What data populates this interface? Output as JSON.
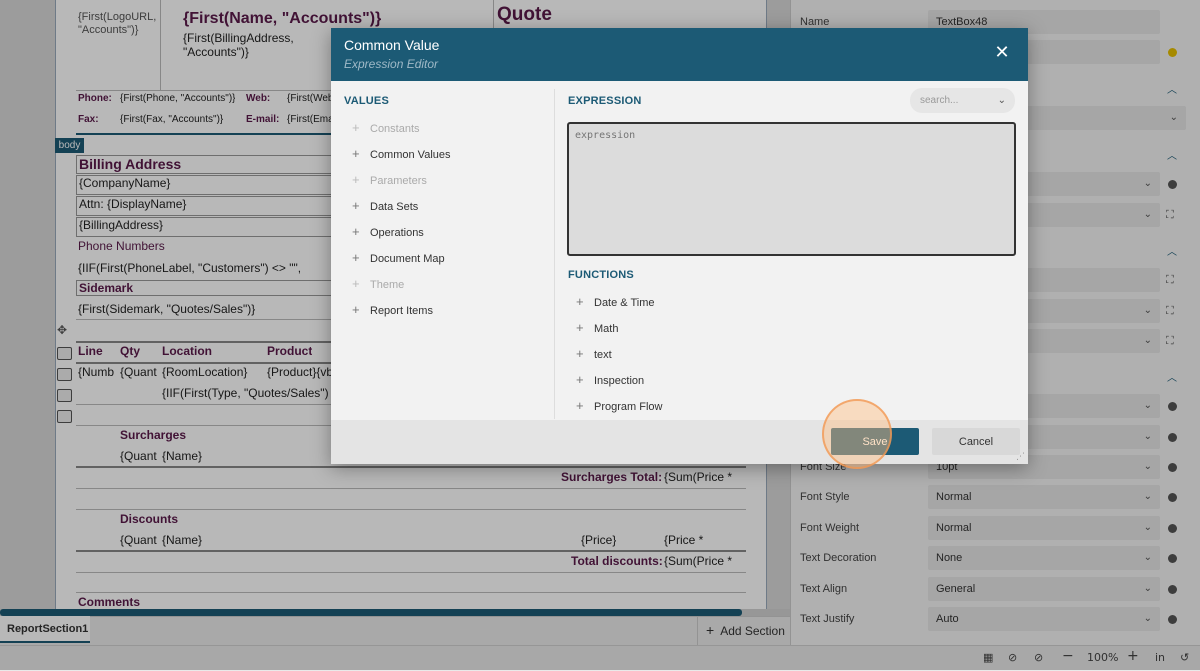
{
  "report": {
    "logo_field": "{First(LogoURL, \"Accounts\")}",
    "name_field": "{First(Name, \"Accounts\")}",
    "billing_addr_field": "{First(BillingAddress, \"Accounts\")}",
    "quote_title": "Quote",
    "phone_label": "Phone:",
    "phone_field": "{First(Phone, \"Accounts\")}",
    "web_label": "Web:",
    "web_field": "{First(Web",
    "fax_label": "Fax:",
    "fax_field": "{First(Fax, \"Accounts\")}",
    "email_label": "E-mail:",
    "email_field": "{First(Ema",
    "body_tag": "body",
    "billing_address_title": "Billing Address",
    "company_name": "{CompanyName}",
    "attn": "Attn: {DisplayName}",
    "billing_address": "{BillingAddress}",
    "phone_numbers": "Phone Numbers",
    "iif_phone": "{IIF(First(PhoneLabel, \"Customers\") <> \"\",",
    "sidemark_title": "Sidemark",
    "sidemark_field": "{First(Sidemark, \"Quotes/Sales\")}",
    "col_line": "Line",
    "col_qty": "Qty",
    "col_location": "Location",
    "col_product": "Product",
    "row_numb": "{Numb",
    "row_quant": "{Quant",
    "row_roomlocation": "{RoomLocation}",
    "row_product": "{Product}{vb",
    "iif_type": "{IIF(First(Type, \"Quotes/Sales\") =",
    "surcharges_title": "Surcharges",
    "surch_quant": "{Quant",
    "surch_name": "{Name}",
    "surcharges_total_label": "Surcharges Total:",
    "surcharges_total_field": "{Sum(Price *",
    "discounts_title": "Discounts",
    "disc_quant": "{Quant",
    "disc_name": "{Name}",
    "disc_price": "{Price}",
    "disc_price2": "{Price *",
    "total_discounts_label": "Total discounts:",
    "total_discounts_field": "{Sum(Price *",
    "comments_title": "Comments"
  },
  "footer": {
    "section_tab": "ReportSection1",
    "add_section": "Add Section"
  },
  "properties": {
    "name_label": "Name",
    "name_value": "TextBox48",
    "rows": [
      {
        "label": "Font Size",
        "value": "10pt"
      },
      {
        "label": "Font Style",
        "value": "Normal"
      },
      {
        "label": "Font Weight",
        "value": "Normal"
      },
      {
        "label": "Text Decoration",
        "value": "None"
      },
      {
        "label": "Text Align",
        "value": "General"
      },
      {
        "label": "Text Justify",
        "value": "Auto"
      }
    ]
  },
  "statusbar": {
    "zoom": "100%",
    "unit": "in"
  },
  "dialog": {
    "title": "Common Value",
    "subtitle": "Expression Editor",
    "values_header": "VALUES",
    "values": [
      {
        "label": "Constants",
        "enabled": false
      },
      {
        "label": "Common Values",
        "enabled": true
      },
      {
        "label": "Parameters",
        "enabled": false
      },
      {
        "label": "Data Sets",
        "enabled": true
      },
      {
        "label": "Operations",
        "enabled": true
      },
      {
        "label": "Document Map",
        "enabled": true
      },
      {
        "label": "Theme",
        "enabled": false
      },
      {
        "label": "Report Items",
        "enabled": true
      }
    ],
    "expression_header": "EXPRESSION",
    "search_placeholder": "search...",
    "expression_placeholder": "expression",
    "functions_header": "FUNCTIONS",
    "functions": [
      "Date & Time",
      "Math",
      "text",
      "Inspection",
      "Program Flow"
    ],
    "save_label": "Save",
    "cancel_label": "Cancel"
  },
  "colors": {
    "accent": "#1c5a75",
    "report_heading": "#5a1a4a",
    "highlight": "#f0a060"
  },
  "icons": [
    "close-icon",
    "plus-icon",
    "chevron-down-icon",
    "expand-icon",
    "move-icon",
    "table-icon",
    "zoom-out-icon",
    "zoom-in-icon",
    "grid-icon",
    "history-icon",
    "resize-grip-icon"
  ]
}
